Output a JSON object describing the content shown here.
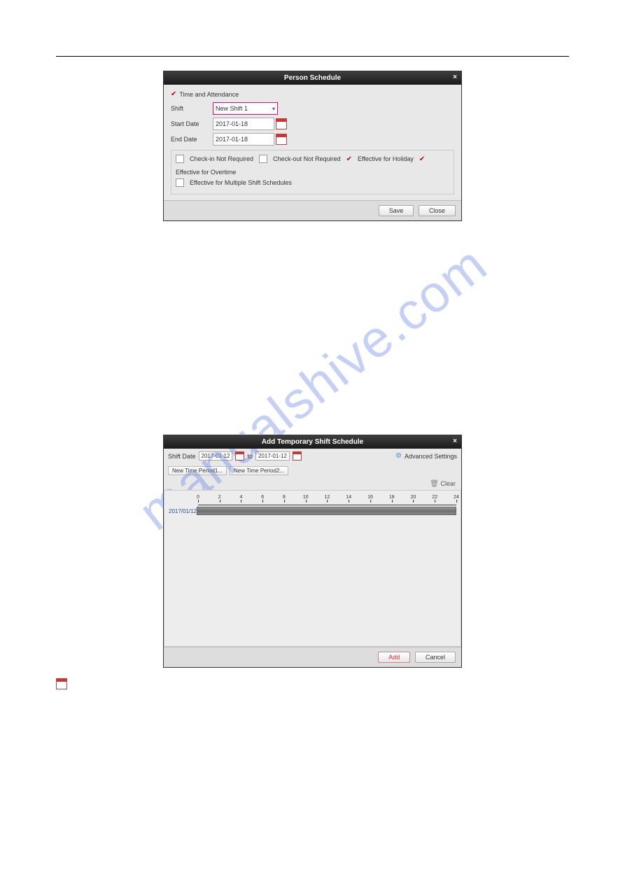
{
  "watermark": "manualshive.com",
  "dialog1": {
    "title": "Person Schedule",
    "ta_label": "Time and Attendance",
    "shift_label": "Shift",
    "shift_value": "New Shift 1",
    "start_label": "Start Date",
    "start_value": "2017-01-18",
    "end_label": "End Date",
    "end_value": "2017-01-18",
    "opt1": "Check-in Not Required",
    "opt2": "Check-out Not Required",
    "opt3": "Effective for Holiday",
    "opt4": "Effective for Overtime",
    "opt5": "Effective for Multiple Shift Schedules",
    "save": "Save",
    "close": "Close"
  },
  "dialog2": {
    "title": "Add Temporary Shift Schedule",
    "shift_date_label": "Shift Date",
    "date1": "2017-01-12",
    "to": "to",
    "date2": "2017-01-12",
    "adv": "Advanced Settings",
    "period1": "New Time Period1...",
    "period2": "New Time Period2...",
    "clear": "Clear",
    "row_date": "2017/01/12",
    "ticks": [
      "0",
      "2",
      "4",
      "6",
      "8",
      "10",
      "12",
      "14",
      "16",
      "18",
      "20",
      "22",
      "24"
    ],
    "add": "Add",
    "cancel": "Cancel"
  }
}
